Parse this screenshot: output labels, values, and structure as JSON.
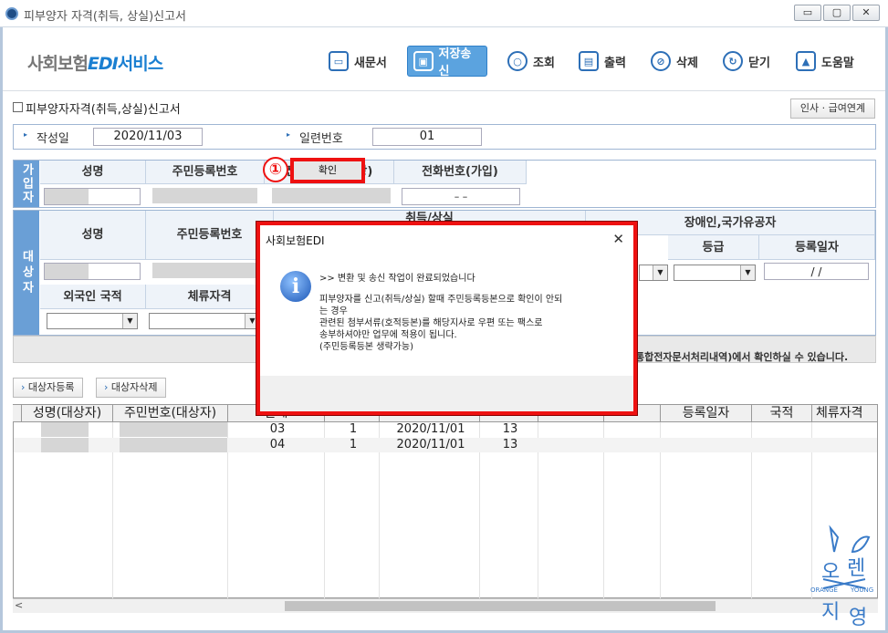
{
  "window": {
    "title": "피부양자 자격(취득, 상실)신고서",
    "controls": [
      "▭",
      "▢",
      "✕"
    ]
  },
  "brand": {
    "part1": "사회보험",
    "part2": "EDI",
    "part3": "서비스"
  },
  "toolbar": [
    {
      "label": "새문서",
      "icon": "book-icon",
      "glyph": "▭"
    },
    {
      "label": "저장송신",
      "icon": "save-icon",
      "glyph": "▣"
    },
    {
      "label": "조회",
      "icon": "search-icon",
      "glyph": "○"
    },
    {
      "label": "출력",
      "icon": "print-icon",
      "glyph": "▤"
    },
    {
      "label": "삭제",
      "icon": "delete-icon",
      "glyph": "⊘"
    },
    {
      "label": "닫기",
      "icon": "close-icon",
      "glyph": "↻"
    },
    {
      "label": "도움말",
      "icon": "help-icon",
      "glyph": "▲"
    }
  ],
  "form": {
    "title": "피부양자자격(취득,상실)신고서",
    "insa_button": "인사 · 급여연계",
    "date_label": "작성일",
    "date_value": "2020/11/03",
    "serial_label": "일련번호",
    "serial_value": "01"
  },
  "subscriber": {
    "side": "가입자",
    "cols": [
      "성명",
      "주민등록번호",
      "전화번호(사업장)",
      "전화번호(가입)"
    ],
    "phone_placeholder": "–       –"
  },
  "dependent": {
    "side": "대상자",
    "cols": [
      "성명",
      "주민등록번호"
    ],
    "group_partial": "취득/상실",
    "disabled_group": "장애인,국가유공자",
    "disabled_cols": [
      "등급",
      "등록일자"
    ],
    "reg_date_placeholder": "/  /",
    "row2": [
      "외국인 국적",
      "체류자격"
    ]
  },
  "notice_tail": "통합전자문서처리내역)에서 확인하실 수 있습니다.",
  "buttons": {
    "register": "대상자등록",
    "delete": "대상자삭제"
  },
  "grid": {
    "headers": [
      "성명(대상자)",
      "주민번호(대상자)",
      "관계",
      "",
      "",
      "",
      "",
      "",
      "",
      "등록일자",
      "국적",
      "체류자격"
    ],
    "rows": [
      [
        "",
        "",
        "03",
        "1",
        "2020/11/01",
        "13"
      ],
      [
        "",
        "",
        "04",
        "1",
        "2020/11/01",
        "13"
      ]
    ]
  },
  "dialog": {
    "title": "사회보험EDI",
    "close": "✕",
    "info": "i",
    "lines": [
      ">> 변환 및 송신 작업이 완료되었습니다",
      "",
      "피부양자를 신고(취득/상실) 할때 주민등록등본으로 확인이 안되",
      "는 경우",
      "관련된 첨부서류(호적등본)를 해당지사로 우편 또는 팩스로",
      "송부하셔야만 업무에 적용이 됩니다.",
      "(주민등록등본 생략가능)"
    ],
    "ok": "확인",
    "marker": "①"
  },
  "watermark": {
    "text1": "오",
    "text2": "렌",
    "text3": "지",
    "text4": "영",
    "en1": "ORANGE",
    "en2": "YOUNG"
  }
}
